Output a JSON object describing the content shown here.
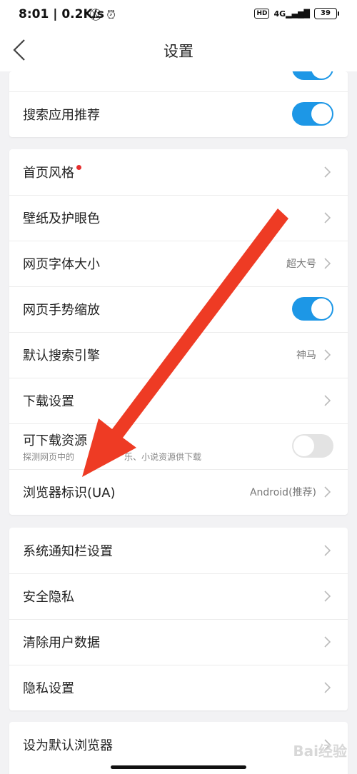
{
  "status_bar": {
    "time_speed": "8:01 | 0.2K/s",
    "network": "HD",
    "signal": "4G",
    "battery": "39"
  },
  "nav": {
    "title": "设置"
  },
  "sections": [
    {
      "rows": [
        {
          "label": "搜索应用推荐",
          "type": "toggle",
          "on": true
        }
      ]
    },
    {
      "rows": [
        {
          "label": "首页风格",
          "type": "link",
          "badge": "red-dot"
        },
        {
          "label": "壁纸及护眼色",
          "type": "link"
        },
        {
          "label": "网页字体大小",
          "type": "link",
          "value": "超大号"
        },
        {
          "label": "网页手势缩放",
          "type": "toggle",
          "on": true
        },
        {
          "label": "默认搜索引擎",
          "type": "link",
          "value": "神马"
        },
        {
          "label": "下载设置",
          "type": "link"
        },
        {
          "label": "可下载资源",
          "sublabel": "探测网页中的",
          "sublabel_tail": "乐、小说资源供下载",
          "type": "toggle",
          "on": false
        },
        {
          "label": "浏览器标识(UA)",
          "type": "link",
          "value": "Android(推荐)"
        }
      ]
    },
    {
      "rows": [
        {
          "label": "系统通知栏设置",
          "type": "link"
        },
        {
          "label": "安全隐私",
          "type": "link"
        },
        {
          "label": "清除用户数据",
          "type": "link"
        },
        {
          "label": "隐私设置",
          "type": "link"
        }
      ]
    },
    {
      "rows": [
        {
          "label": "设为默认浏览器",
          "type": "link"
        }
      ]
    }
  ],
  "colors": {
    "toggle_on": "#1d97e6",
    "toggle_off": "#e3e3e3",
    "arrow": "#ee3b24",
    "badge": "#e52e2e"
  },
  "watermark": "Bai经验"
}
